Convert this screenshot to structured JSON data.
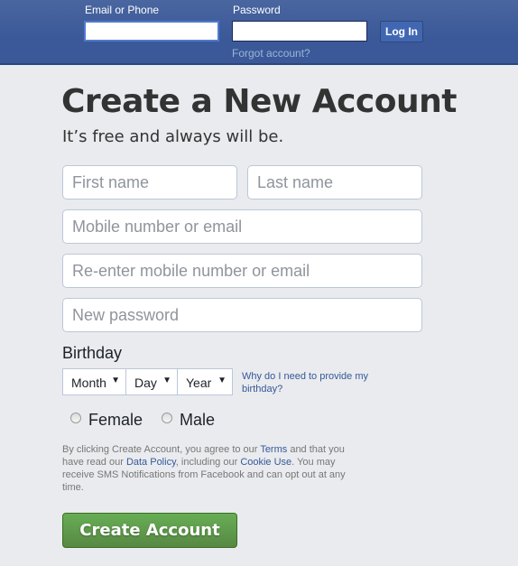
{
  "header": {
    "email_label": "Email or Phone",
    "password_label": "Password",
    "email_value": "",
    "password_value": "",
    "login_label": "Log In",
    "forgot_label": "Forgot account?"
  },
  "signup": {
    "title": "Create a New Account",
    "subtitle": "It’s free and always will be.",
    "first_name_placeholder": "First name",
    "last_name_placeholder": "Last name",
    "mobile_placeholder": "Mobile number or email",
    "reenter_placeholder": "Re-enter mobile number or email",
    "password_placeholder": "New password",
    "birthday_label": "Birthday",
    "month_selected": "Month",
    "day_selected": "Day",
    "year_selected": "Year",
    "why_birthday": "Why do I need to provide my birthday?",
    "gender_female": "Female",
    "gender_male": "Male",
    "terms": {
      "t1": "By clicking Create Account, you agree to our ",
      "terms_link": "Terms",
      "t2": " and that you have read our ",
      "data_policy_link": "Data Policy",
      "t3": ", including our ",
      "cookie_link": "Cookie Use",
      "t4": ". You may receive SMS Notifications from Facebook and can opt out at any time."
    },
    "create_label": "Create Account"
  },
  "icons": {
    "dropdown_arrow": "▼"
  },
  "colors": {
    "brand_blue": "#3b5998",
    "create_green": "#5fa04a",
    "link_blue": "#365899",
    "background": "#e9ebee"
  }
}
